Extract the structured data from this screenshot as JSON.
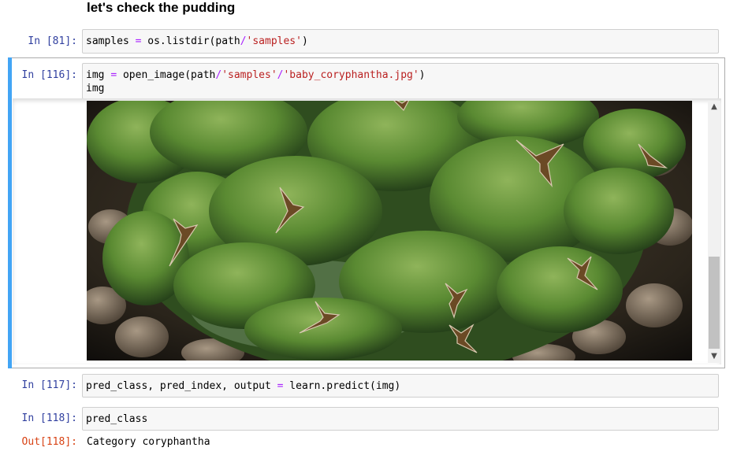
{
  "heading": "let's check the pudding",
  "cells": [
    {
      "prompt": "In [81]:",
      "code_parts": [
        "samples ",
        "=",
        " os.listdir(path",
        "/",
        "'samples'",
        ")"
      ]
    },
    {
      "prompt": "In [116]:",
      "line1_parts": [
        "img ",
        "=",
        " open_image(path",
        "/",
        "'samples'",
        "/",
        "'baby_coryphantha.jpg'",
        ")"
      ],
      "line2": "img"
    },
    {
      "prompt": "In [117]:",
      "code_parts": [
        "pred_class, pred_index, output ",
        "=",
        " learn.predict(img)"
      ]
    },
    {
      "prompt": "In [118]:",
      "code": "pred_class"
    }
  ],
  "output": {
    "prompt": "Out[118]:",
    "text": "Category coryphantha"
  },
  "image_subject": "baby coryphantha cactus photo",
  "colors": {
    "in_prompt": "#303f9f",
    "out_prompt": "#d84315",
    "selected_bar": "#42a5f5",
    "operator": "#aa22ff",
    "string": "#ba2121"
  },
  "icons": {
    "scroll_up": "▲",
    "scroll_down": "▼"
  }
}
